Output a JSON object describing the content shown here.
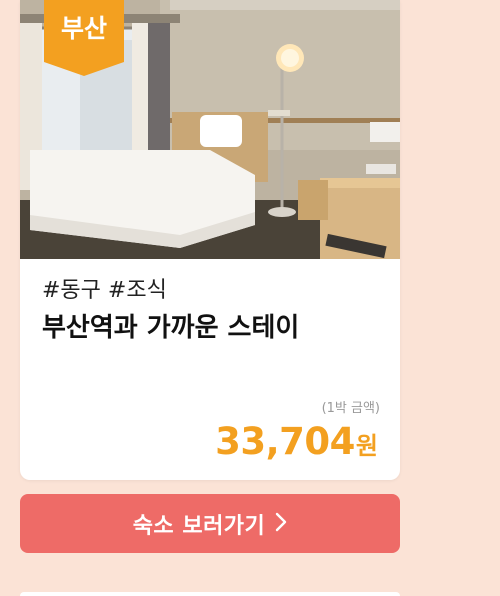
{
  "card": {
    "badge": "부산",
    "tags": "#동구 #조식",
    "title": "부산역과 가까운 스테이",
    "price_note": "(1박 금액)",
    "price": "33,704",
    "price_unit": "원",
    "photo_icon": "hotel-room-photo"
  },
  "cta": {
    "label": "숙소 보러가기",
    "icon": "chevron-right-icon"
  },
  "colors": {
    "page_background": "#fbe3d6",
    "badge": "#f3a020",
    "price": "#f3a020",
    "cta_background": "#ee6b67",
    "card_background": "#ffffff"
  }
}
